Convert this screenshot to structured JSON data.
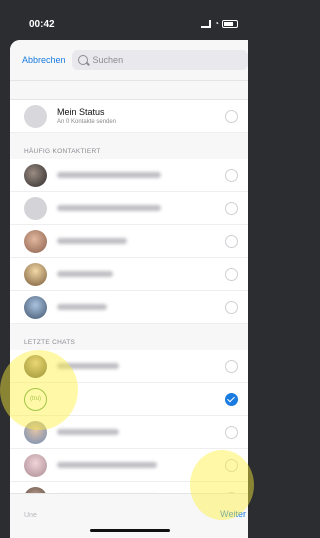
{
  "statusbar": {
    "time": "00:42"
  },
  "topbar": {
    "cancel_label": "Abbrechen",
    "search_placeholder": "Suchen"
  },
  "my_status": {
    "title": "Mein Status",
    "subtitle": "An 0 Kontakte senden"
  },
  "sections": {
    "frequent": "HÄUFIG KONTAKTIERT",
    "recent": "LETZTE CHATS"
  },
  "group_chat": {
    "label": "(tru)"
  },
  "footer": {
    "left_text": "Une",
    "next_label": "Weiter"
  },
  "colors": {
    "accent": "#1a7ce0",
    "highlight": "#fff03c"
  }
}
